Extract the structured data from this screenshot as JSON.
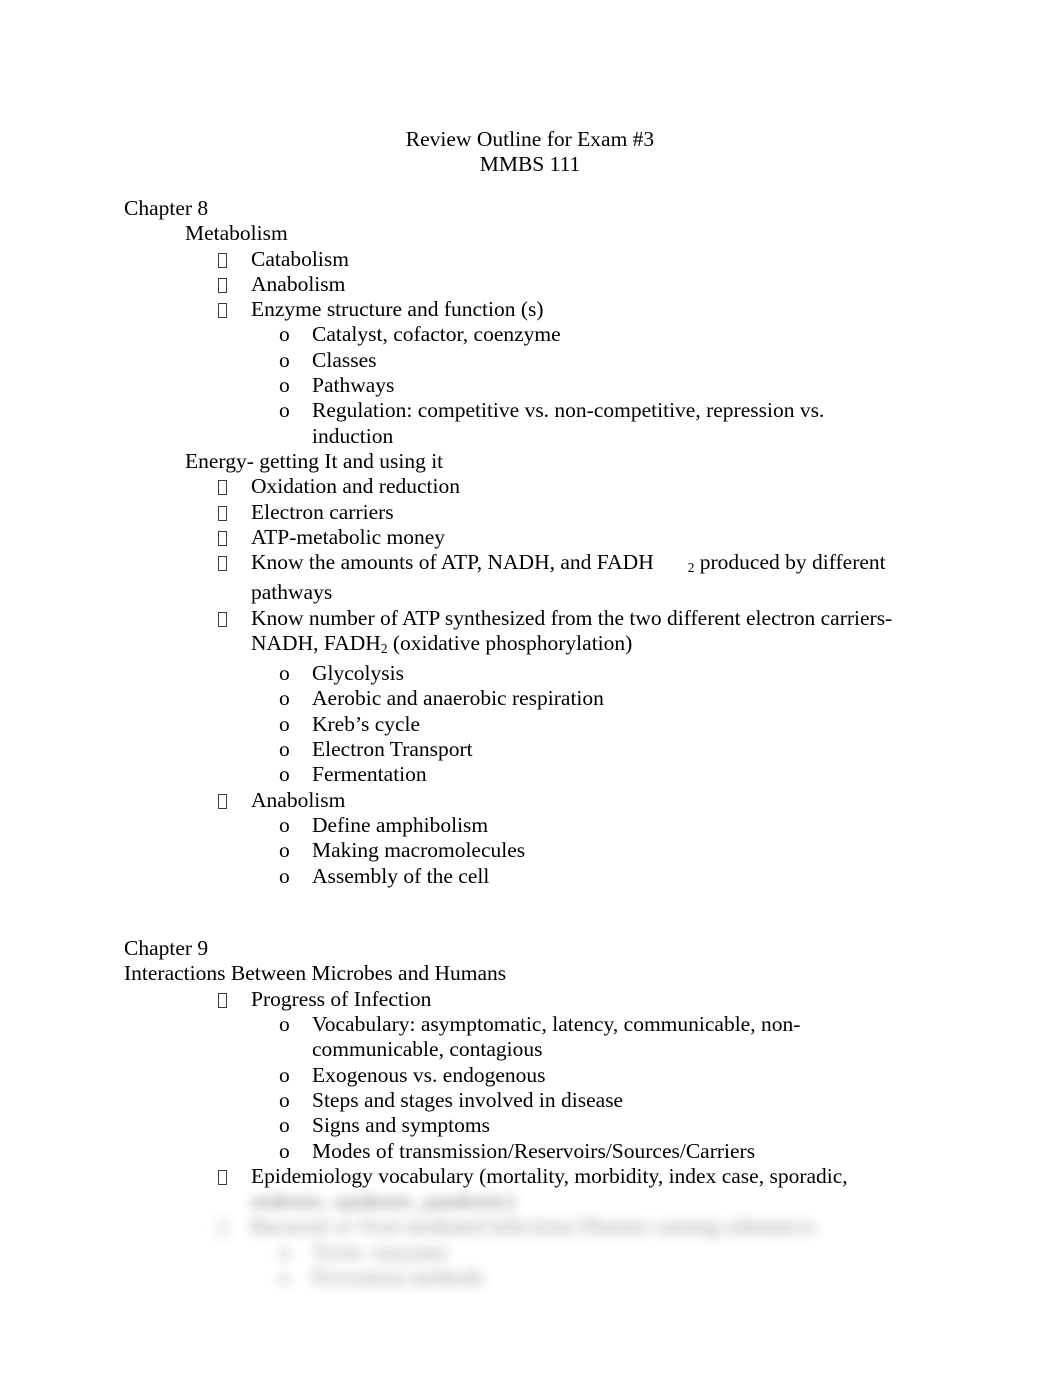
{
  "document": {
    "title_line_1": "Review Outline for Exam #3",
    "title_line_2": "MMBS 111"
  },
  "chapter8": {
    "heading": "Chapter 8",
    "section_1": {
      "heading": "Metabolism",
      "items": [
        {
          "label": "Catabolism",
          "children": []
        },
        {
          "label": "Anabolism",
          "children": []
        },
        {
          "label": "Enzyme structure and function (s)",
          "children": [
            "Catalyst, cofactor, coenzyme",
            "Classes",
            "Pathways",
            "Regulation: competitive vs. non-competitive, repression vs. induction"
          ]
        }
      ]
    },
    "section_2": {
      "heading": "Energy- getting It and using it",
      "items": [
        {
          "label": "Oxidation and reduction",
          "children": []
        },
        {
          "label": "Electron carriers",
          "children": []
        },
        {
          "label": "ATP-metabolic money",
          "children": []
        },
        {
          "label_prefix": "Know the amounts of ATP, NADH, and FADH",
          "label_subscript": "2",
          "label_suffix": " produced by different pathways",
          "children": []
        },
        {
          "label_prefix": "Know number of ATP synthesized from the two different electron carriers- NADH, FADH",
          "label_subscript": "2",
          "label_suffix": " (oxidative phosphorylation)",
          "children": [
            "Glycolysis",
            "Aerobic and anaerobic respiration",
            "Kreb’s cycle",
            "Electron Transport",
            "Fermentation"
          ]
        },
        {
          "label": "Anabolism",
          "children": [
            "Define amphibolism",
            "Making macromolecules",
            "Assembly of the cell"
          ]
        }
      ]
    }
  },
  "chapter9": {
    "heading": "Chapter 9",
    "subheading": "Interactions Between Microbes and Humans",
    "items": [
      {
        "label": "Progress of Infection",
        "children": [
          "Vocabulary: asymptomatic, latency, communicable, non-communicable, contagious",
          "Exogenous vs. endogenous",
          "Steps and stages involved in disease",
          "Signs and symptoms",
          "Modes of transmission/Reservoirs/Sources/Carriers"
        ]
      },
      {
        "label": "Epidemiology vocabulary (mortality, morbidity, index case, sporadic,",
        "children": []
      }
    ],
    "obscured": {
      "line_1": "endemic, epidemic, pandemic)",
      "line_2": "Bacterial or Viral mediated Infectious Disease causing substances",
      "line_3": "Toxin  enzymes",
      "line_4": "Prevention methods",
      "note": "blurred"
    }
  }
}
